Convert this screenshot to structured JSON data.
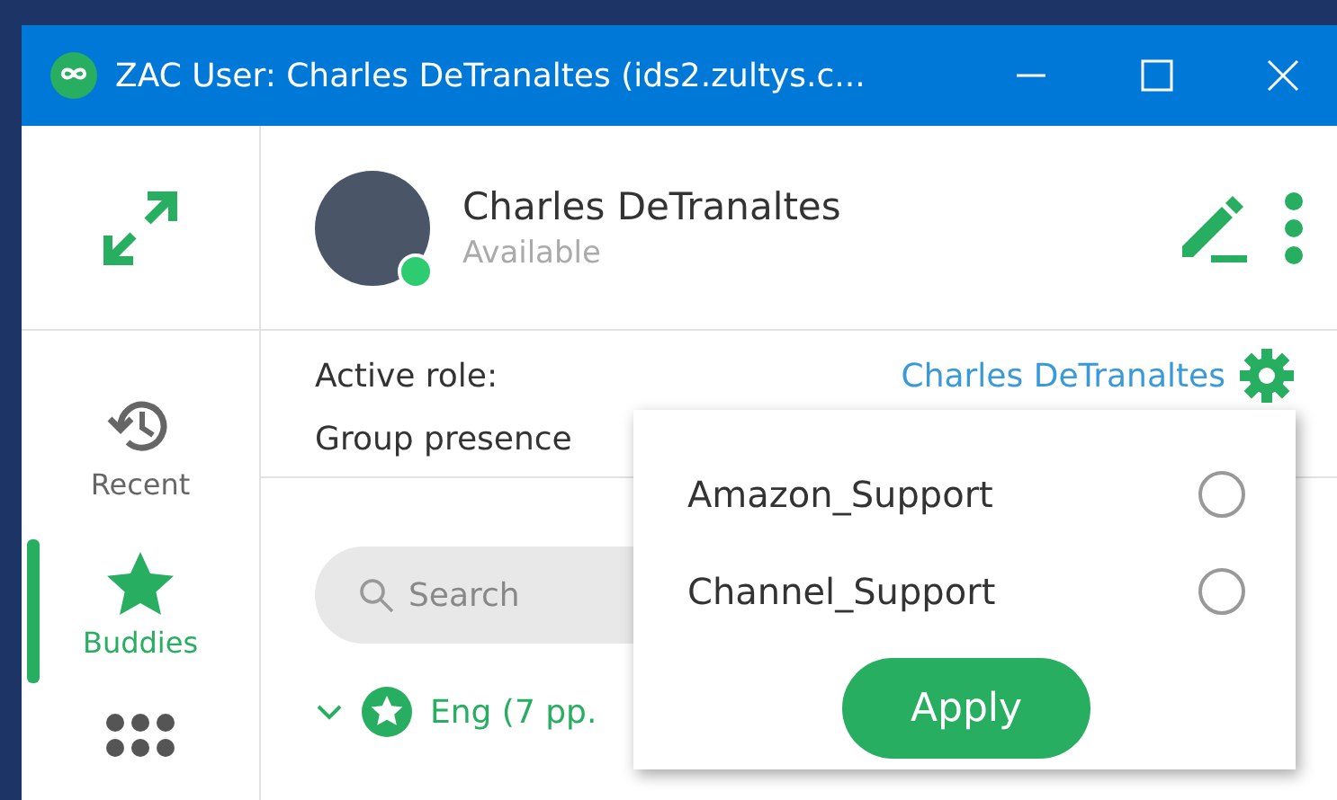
{
  "window": {
    "title": "ZAC User: Charles DeTranaltes (ids2.zultys.c..."
  },
  "sidebar": {
    "items": [
      {
        "label": "Recent",
        "selected": false
      },
      {
        "label": "Buddies",
        "selected": true
      }
    ]
  },
  "profile": {
    "name": "Charles DeTranaltes",
    "status": "Available",
    "online": true
  },
  "roles": {
    "active_role_label": "Active role:",
    "active_role_value": "Charles DeTranaltes",
    "group_presence_label": "Group presence"
  },
  "search": {
    "placeholder": "Search"
  },
  "groups": [
    {
      "name": "Eng (7 pp.",
      "expanded": true
    }
  ],
  "role_popup": {
    "options": [
      {
        "label": "Amazon_Support",
        "selected": false
      },
      {
        "label": "Channel_Support",
        "selected": false
      }
    ],
    "apply_button": "Apply"
  }
}
